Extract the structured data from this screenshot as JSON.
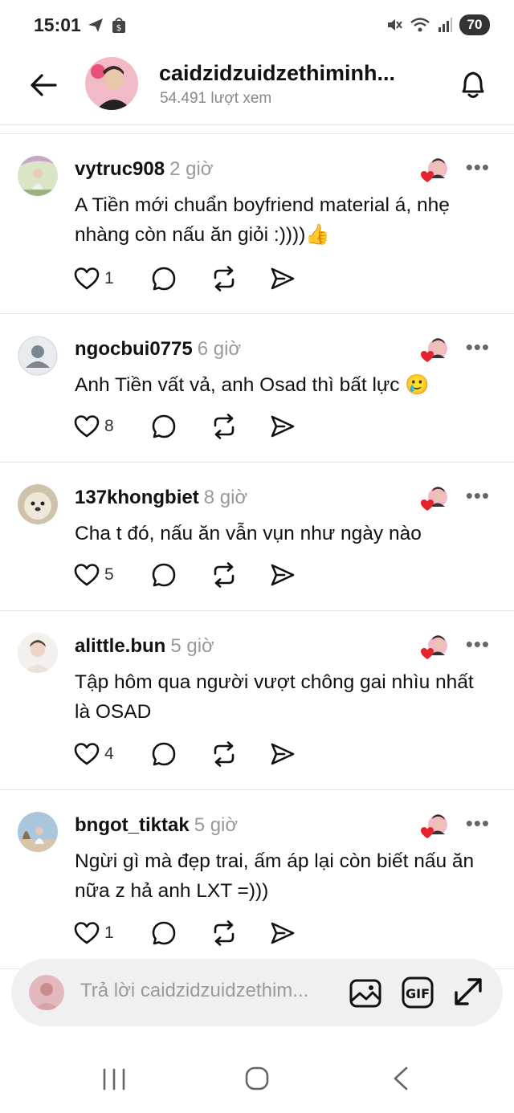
{
  "status": {
    "time": "15:01",
    "battery": "70"
  },
  "header": {
    "title": "caidzidzuidzethiminh...",
    "views": "54.491 lượt xem"
  },
  "comments": [
    {
      "username": "vytruc908",
      "time": "2 giờ",
      "text": "A Tiền mới chuẩn boyfriend material á, nhẹ nhàng còn nấu ăn giỏi :))))👍",
      "likes": "1"
    },
    {
      "username": "ngocbui0775",
      "time": "6 giờ",
      "text": "Anh Tiền vất vả, anh Osad thì bất lực 🥲",
      "likes": "8"
    },
    {
      "username": "137khongbiet",
      "time": "8 giờ",
      "text": "Cha t đó, nấu ăn vẫn vụn như ngày nào",
      "likes": "5"
    },
    {
      "username": "alittle.bun",
      "time": "5 giờ",
      "text": "Tập hôm qua người vượt chông gai nhìu nhất là OSAD",
      "likes": "4"
    },
    {
      "username": "bngot_tiktak",
      "time": "5 giờ",
      "text": "Ngừi gì mà đẹp trai, ấm áp lại còn biết nấu ăn nữa z hả anh LXT =)))",
      "likes": "1"
    }
  ],
  "more_label": "•••",
  "reply": {
    "placeholder": "Trả lời caidzidzuidzethim..."
  },
  "colors": {
    "liked_heart": "#e5232b",
    "icon": "#111111",
    "muted_text": "#999999"
  },
  "icons": [
    "back-arrow-icon",
    "bell-icon",
    "heart-icon",
    "reply-icon",
    "repost-icon",
    "share-icon",
    "image-icon",
    "gif-icon",
    "expand-icon"
  ]
}
